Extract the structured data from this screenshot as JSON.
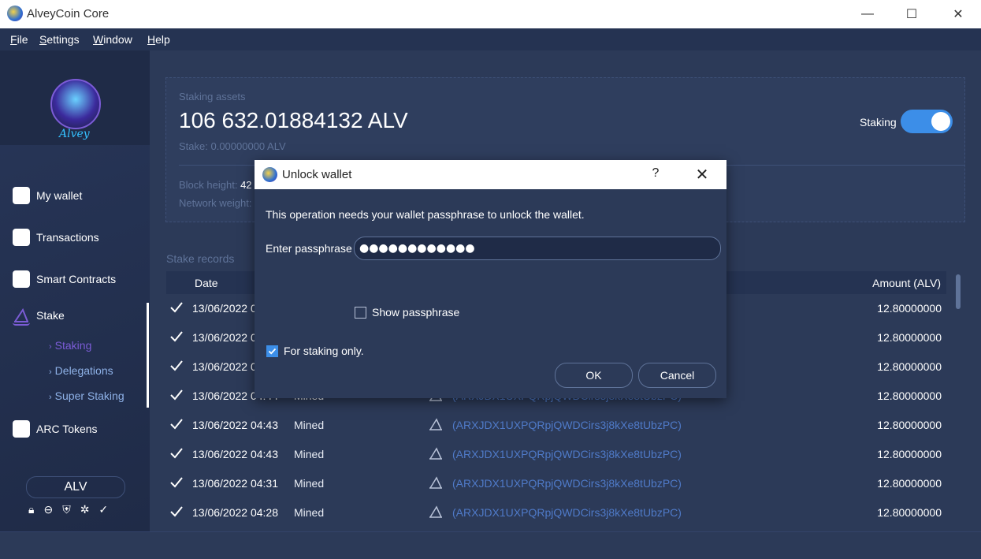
{
  "window": {
    "title": "AlveyCoin Core",
    "minimize": "—",
    "maximize": "☐",
    "close": "✕"
  },
  "menu": {
    "file": "File",
    "settings": "Settings",
    "window": "Window",
    "help": "Help"
  },
  "sidebar": {
    "logo_text": "Alvey",
    "items": [
      {
        "label": "My wallet",
        "icon": "wallet-icon"
      },
      {
        "label": "Transactions",
        "icon": "list-icon"
      },
      {
        "label": "Smart Contracts",
        "icon": "contract-icon"
      },
      {
        "label": "Stake",
        "icon": "stake-icon"
      },
      {
        "label": "ARC Tokens",
        "icon": "token-icon"
      }
    ],
    "stake_sub": [
      "Staking",
      "Delegations",
      "Super Staking"
    ],
    "currency": "ALV",
    "status_icons": [
      "lock-icon",
      "sync-icon",
      "shield-icon",
      "network-icon",
      "check-icon"
    ]
  },
  "assets": {
    "label": "Staking assets",
    "value": "106 632.01884132 ALV",
    "stake_label": "Stake:",
    "stake_value": "0.00000000 ALV",
    "staking_toggle_label": "Staking",
    "staking_on": true,
    "block_height_label": "Block height:",
    "block_height_value": "42",
    "network_weight_label": "Network weight:"
  },
  "records": {
    "label": "Stake records",
    "col_date": "Date",
    "col_amount": "Amount (ALV)",
    "rows": [
      {
        "date": "13/06/2022 0",
        "type": "",
        "addr": "",
        "amount": "12.80000000"
      },
      {
        "date": "13/06/2022 0",
        "type": "",
        "addr": "",
        "amount": "12.80000000"
      },
      {
        "date": "13/06/2022 0",
        "type": "",
        "addr": "",
        "amount": "12.80000000"
      },
      {
        "date": "13/06/2022 04:44",
        "type": "Mined",
        "addr": "(ARXJDX1UXPQRpjQWDCirs3j8kXe8tUbzPC)",
        "amount": "12.80000000"
      },
      {
        "date": "13/06/2022 04:43",
        "type": "Mined",
        "addr": "(ARXJDX1UXPQRpjQWDCirs3j8kXe8tUbzPC)",
        "amount": "12.80000000"
      },
      {
        "date": "13/06/2022 04:43",
        "type": "Mined",
        "addr": "(ARXJDX1UXPQRpjQWDCirs3j8kXe8tUbzPC)",
        "amount": "12.80000000"
      },
      {
        "date": "13/06/2022 04:31",
        "type": "Mined",
        "addr": "(ARXJDX1UXPQRpjQWDCirs3j8kXe8tUbzPC)",
        "amount": "12.80000000"
      },
      {
        "date": "13/06/2022 04:28",
        "type": "Mined",
        "addr": "(ARXJDX1UXPQRpjQWDCirs3j8kXe8tUbzPC)",
        "amount": "12.80000000"
      }
    ]
  },
  "dialog": {
    "title": "Unlock wallet",
    "help": "?",
    "close": "✕",
    "message": "This operation needs your wallet passphrase to unlock the wallet.",
    "passphrase_label": "Enter passphrase",
    "passphrase_value": "●●●●●●●●●●●●",
    "show_passphrase_label": "Show passphrase",
    "show_passphrase_checked": false,
    "staking_only_label": "For staking only.",
    "staking_only_checked": true,
    "ok": "OK",
    "cancel": "Cancel"
  }
}
